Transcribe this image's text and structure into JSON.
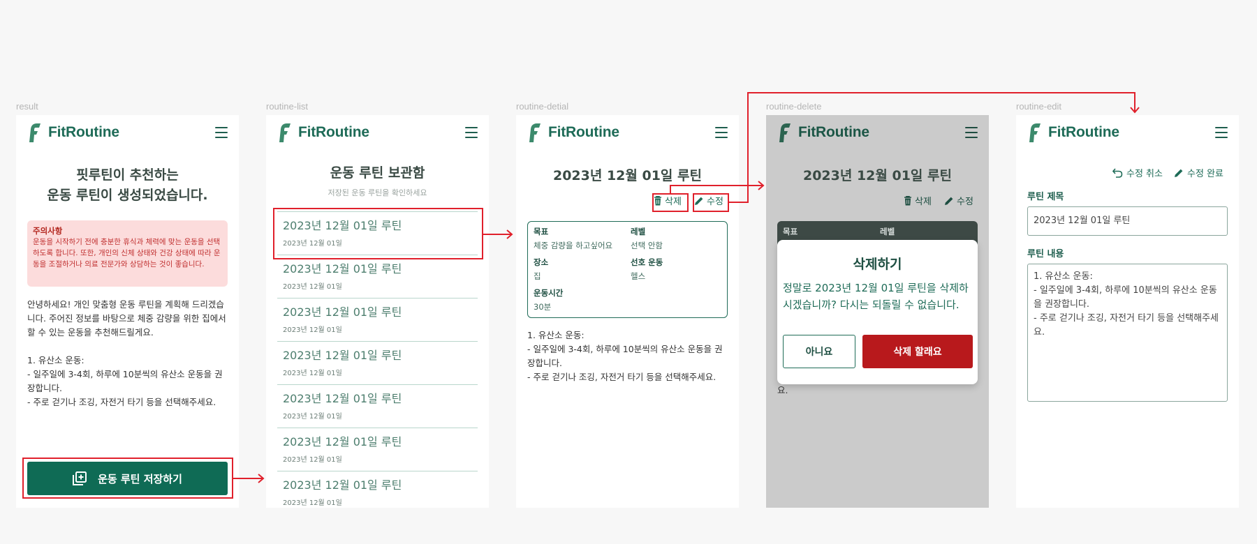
{
  "brand": {
    "name": "FitRoutine",
    "color": "#1e6b57",
    "danger_color": "#b8191c",
    "annotation_color": "#e0202b"
  },
  "frames": {
    "result": "result",
    "list": "routine-list",
    "detail": "routine-detial",
    "delete": "routine-delete",
    "edit": "routine-edit"
  },
  "result": {
    "title_line1": "핏루틴이 추천하는",
    "title_line2": "운동 루틴이 생성되었습니다.",
    "warning_title": "주의사항",
    "warning_body": "운동을 시작하기 전에 충분한 휴식과 체력에 맞는 운동을 선택하도록 합니다. 또한, 개인의 신체 상태와 건강 상태에 따라 운동을 조절하거나 의료 전문가와 상담하는 것이 좋습니다.",
    "intro": "안녕하세요! 개인 맞춤형 운동 루틴을 계획해 드리겠습니다. 주어진 정보를 바탕으로 체중 감량을 위한 집에서 할 수 있는 운동을 추천해드릴게요.",
    "routine": "1. 유산소 운동:\n- 일주일에 3-4회, 하루에 10분씩의 유산소 운동을 권장합니다.\n- 주로 걷기나 조깅, 자전거 타기 등을 선택해주세요.",
    "save_label": "운동 루틴 저장하기"
  },
  "list": {
    "title": "운동 루틴 보관함",
    "subtitle": "저장된 운동 루틴을 확인하세요",
    "items": [
      {
        "title": "2023년 12월 01일 루틴",
        "date": "2023년 12월 01일"
      },
      {
        "title": "2023년 12월 01일 루틴",
        "date": "2023년 12월 01일"
      },
      {
        "title": "2023년 12월 01일 루틴",
        "date": "2023년 12월 01일"
      },
      {
        "title": "2023년 12월 01일 루틴",
        "date": "2023년 12월 01일"
      },
      {
        "title": "2023년 12월 01일 루틴",
        "date": "2023년 12월 01일"
      },
      {
        "title": "2023년 12월 01일 루틴",
        "date": "2023년 12월 01일"
      },
      {
        "title": "2023년 12월 01일 루틴",
        "date": "2023년 12월 01일"
      }
    ]
  },
  "detail": {
    "title": "2023년 12월 01일 루틴",
    "delete_label": "삭제",
    "edit_label": "수정",
    "goal_label": "목표",
    "goal_value": "체중 감량을 하고싶어요",
    "level_label": "레벨",
    "level_value": "선택 안함",
    "place_label": "장소",
    "place_value": "집",
    "pref_label": "선호 운동",
    "pref_value": "헬스",
    "time_label": "운동시간",
    "time_value": "30분",
    "routine": "1. 유산소 운동:\n- 일주일에 3-4회, 하루에 10분씩의 유산소 운동을 권장합니다.\n- 주로 걷기나 조깅, 자전거 타기 등을 선택해주세요."
  },
  "delete_modal": {
    "title": "삭제하기",
    "message": "정말로 2023년 12월 01일 루틴을 삭제하시겠습니까? 다시는 되돌릴 수 없습니다.",
    "cancel_label": "아니요",
    "confirm_label": "삭제 할래요",
    "behind_text": "요."
  },
  "edit": {
    "cancel_label": "수정 취소",
    "done_label": "수정 완료",
    "title_label": "루틴 제목",
    "title_value": "2023년 12월 01일 루틴",
    "content_label": "루틴 내용",
    "content_value": "1. 유산소 운동:\n- 일주일에 3-4회, 하루에 10분씩의 유산소 운동을 권장합니다.\n- 주로 걷기나 조깅, 자전거 타기 등을 선택해주세요."
  }
}
